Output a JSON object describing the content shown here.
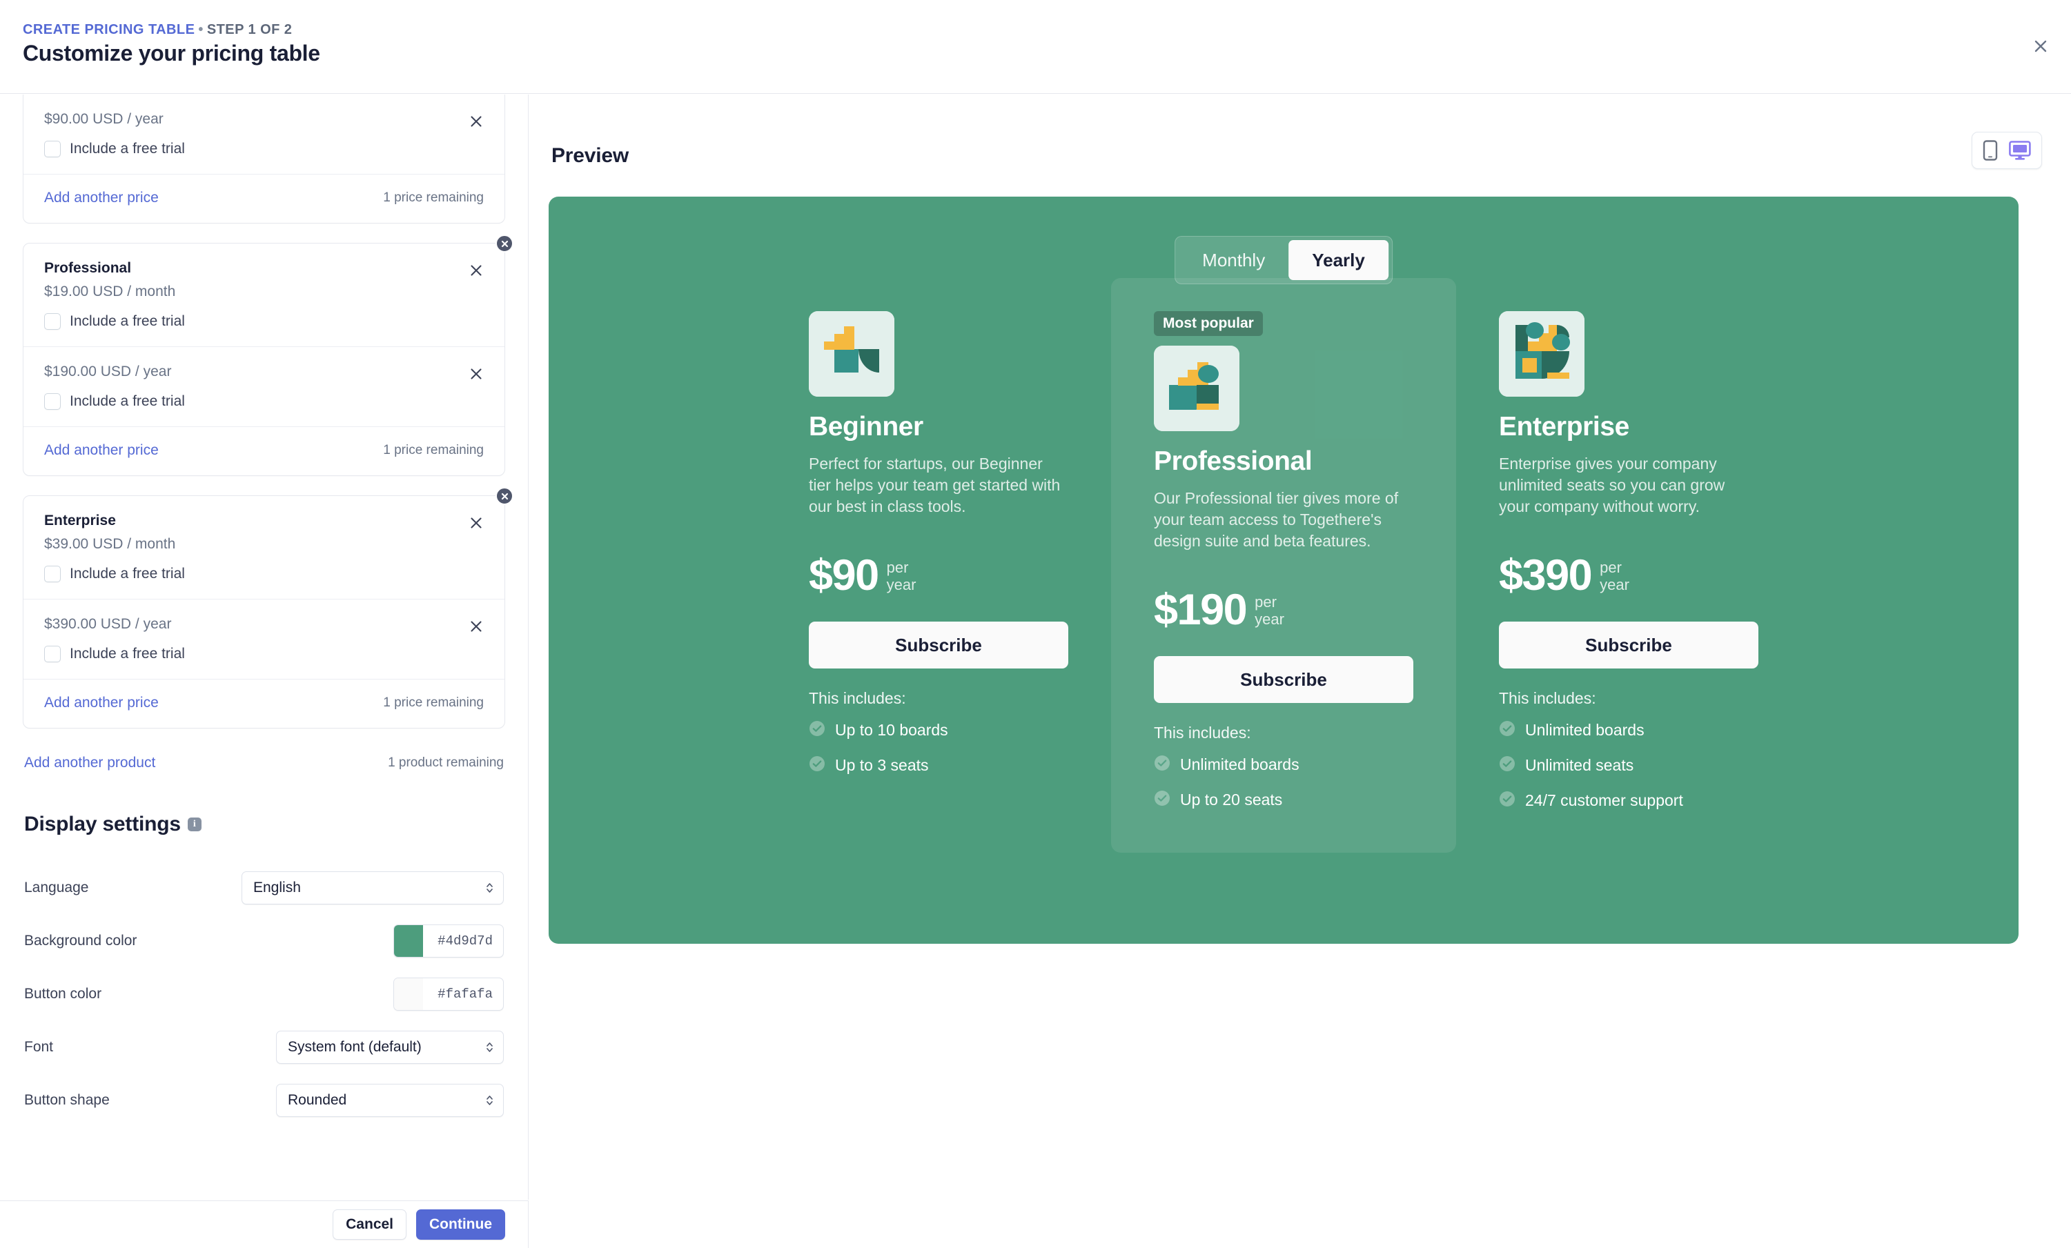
{
  "header": {
    "breadcrumb_link": "CREATE PRICING TABLE",
    "breadcrumb_separator": "•",
    "breadcrumb_step": "STEP 1 OF 2",
    "title": "Customize your pricing table",
    "close_icon": "close-icon"
  },
  "sidebar": {
    "products": [
      {
        "clipped": true,
        "name": "",
        "prices": [
          {
            "label": "$90.00 USD / year",
            "trial_label": "Include a free trial",
            "trial_checked": false
          }
        ],
        "add_price_label": "Add another price",
        "price_remaining": "1 price remaining"
      },
      {
        "clipped": false,
        "name": "Professional",
        "prices": [
          {
            "label": "$19.00 USD / month",
            "trial_label": "Include a free trial",
            "trial_checked": false
          },
          {
            "label": "$190.00 USD / year",
            "trial_label": "Include a free trial",
            "trial_checked": false
          }
        ],
        "add_price_label": "Add another price",
        "price_remaining": "1 price remaining"
      },
      {
        "clipped": false,
        "name": "Enterprise",
        "prices": [
          {
            "label": "$39.00 USD / month",
            "trial_label": "Include a free trial",
            "trial_checked": false
          },
          {
            "label": "$390.00 USD / year",
            "trial_label": "Include a free trial",
            "trial_checked": false
          }
        ],
        "add_price_label": "Add another price",
        "price_remaining": "1 price remaining"
      }
    ],
    "add_product_label": "Add another product",
    "product_remaining": "1 product remaining",
    "display_settings": {
      "title": "Display settings",
      "info_icon": "info-icon",
      "rows": {
        "language": {
          "label": "Language",
          "value": "English"
        },
        "background_color": {
          "label": "Background color",
          "value": "#4d9d7d"
        },
        "button_color": {
          "label": "Button color",
          "value": "#fafafa"
        },
        "font": {
          "label": "Font",
          "value": "System font (default)"
        },
        "button_shape": {
          "label": "Button shape",
          "value": "Rounded"
        }
      }
    }
  },
  "footer": {
    "cancel_label": "Cancel",
    "continue_label": "Continue"
  },
  "preview": {
    "title": "Preview",
    "device_mobile_icon": "mobile-icon",
    "device_desktop_icon": "desktop-icon",
    "active_device": "desktop",
    "background_color": "#4d9d7d",
    "button_color": "#fafafa",
    "billing_toggle": {
      "options": [
        "Monthly",
        "Yearly"
      ],
      "selected": "Yearly"
    },
    "tiers": [
      {
        "badge": "",
        "featured": false,
        "name": "Beginner",
        "description": "Perfect for startups, our Beginner tier helps your team get started with our best in class tools.",
        "price": "$90",
        "per_line_1": "per",
        "per_line_2": "year",
        "cta": "Subscribe",
        "includes_label": "This includes:",
        "features": [
          "Up to 10 boards",
          "Up to 3 seats"
        ]
      },
      {
        "badge": "Most popular",
        "featured": true,
        "name": "Professional",
        "description": "Our Professional tier gives more of your team access to Togethere's design suite and beta features.",
        "price": "$190",
        "per_line_1": "per",
        "per_line_2": "year",
        "cta": "Subscribe",
        "includes_label": "This includes:",
        "features": [
          "Unlimited boards",
          "Up to 20 seats"
        ]
      },
      {
        "badge": "",
        "featured": false,
        "name": "Enterprise",
        "description": "Enterprise gives your company unlimited seats so you can grow your company without worry.",
        "price": "$390",
        "per_line_1": "per",
        "per_line_2": "year",
        "cta": "Subscribe",
        "includes_label": "This includes:",
        "features": [
          "Unlimited boards",
          "Unlimited seats",
          "24/7 customer support"
        ]
      }
    ]
  },
  "colors": {
    "accent": "#5469d4",
    "preview_bg": "#4d9d7d",
    "tier_icon_bg": "#e3f0ec",
    "icon_teal": "#2f9488",
    "icon_dark_teal": "#2a6b5d",
    "icon_yellow": "#f5b93f"
  }
}
